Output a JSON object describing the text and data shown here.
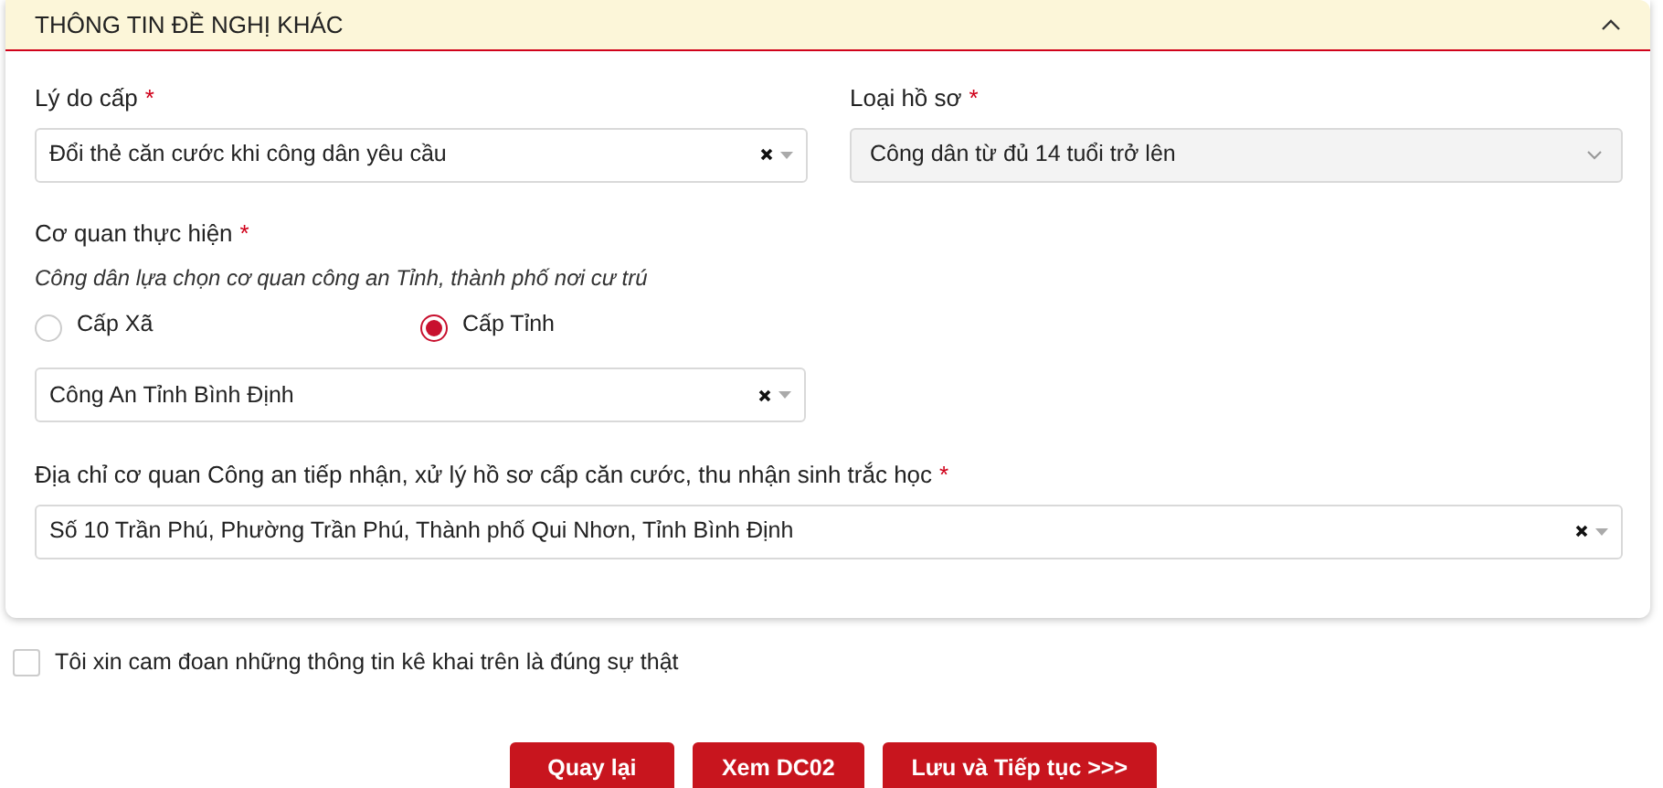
{
  "section": {
    "title": "THÔNG TIN ĐỀ NGHỊ KHÁC",
    "expanded": true
  },
  "reason": {
    "label": "Lý do cấp",
    "required_mark": "*",
    "value": "Đổi thẻ căn cước khi công dân yêu cầu",
    "clearable": true,
    "disabled": false
  },
  "profile_type": {
    "label": "Loại hồ sơ",
    "required_mark": "*",
    "value": "Công dân từ đủ 14 tuổi trở lên",
    "clearable": false,
    "disabled": true
  },
  "agency": {
    "label": "Cơ quan thực hiện",
    "required_mark": "*",
    "hint": "Công dân lựa chọn cơ quan công an Tỉnh, thành phố nơi cư trú",
    "options": [
      {
        "label": "Cấp Xã",
        "selected": false
      },
      {
        "label": "Cấp Tỉnh",
        "selected": true
      }
    ],
    "select": {
      "value": "Công An Tỉnh Bình Định",
      "clearable": true,
      "disabled": false
    }
  },
  "address": {
    "label": "Địa chỉ cơ quan Công an tiếp nhận, xử lý hồ sơ cấp căn cước, thu nhận sinh trắc học",
    "required_mark": "*",
    "value": "Số 10 Trần Phú, Phường Trần Phú, Thành phố Qui Nhơn, Tỉnh Bình Định",
    "clearable": true,
    "disabled": false
  },
  "commitment": {
    "label": "Tôi xin cam đoan những thông tin kê khai trên là đúng sự thật",
    "checked": false
  },
  "buttons": [
    "Quay lại",
    "Xem DC02",
    "Lưu và Tiếp tục >>>"
  ]
}
